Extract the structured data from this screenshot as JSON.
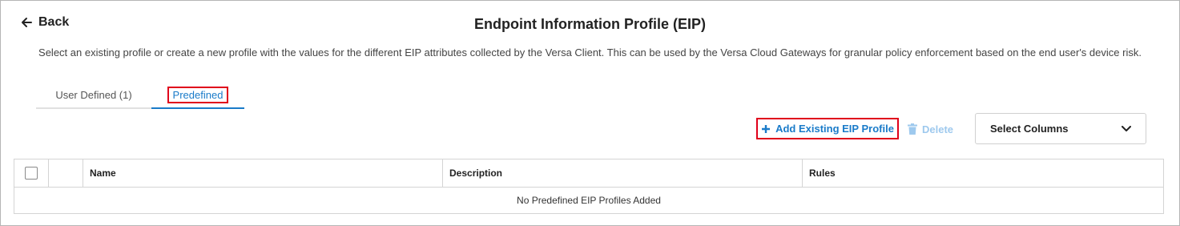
{
  "header": {
    "back_label": "Back",
    "title": "Endpoint Information Profile (EIP)",
    "description": "Select an existing profile or create a new profile with the values for the different EIP attributes collected by the Versa Client. This can be used by the Versa Cloud Gateways for granular policy enforcement based on the end user's device risk."
  },
  "tabs": [
    {
      "label": "User Defined (1)",
      "active": false
    },
    {
      "label": "Predefined",
      "active": true
    }
  ],
  "toolbar": {
    "add_label": "Add Existing EIP Profile",
    "delete_label": "Delete",
    "select_columns_label": "Select Columns"
  },
  "table": {
    "columns": [
      "Name",
      "Description",
      "Rules"
    ],
    "empty_message": "No Predefined EIP Profiles Added"
  },
  "colors": {
    "accent": "#1a7bc9",
    "highlight": "#e0001b",
    "disabled": "#9ec9ee"
  },
  "icons": {
    "back": "arrow-left-icon",
    "add": "plus-icon",
    "delete": "trash-icon",
    "dropdown": "chevron-down-icon"
  }
}
